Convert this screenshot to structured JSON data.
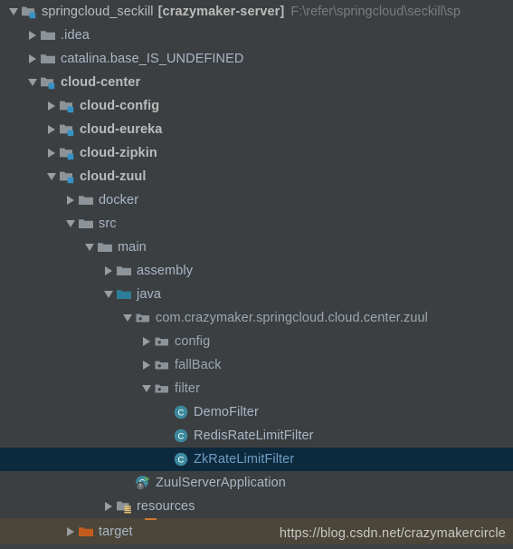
{
  "window": {
    "kind": "ide-project-tree",
    "background_color": "#3c3f41",
    "selection_color": "#0d293e",
    "bottom_bar_color": "#4b4639"
  },
  "project": {
    "name": "springcloud_seckill",
    "module_tag": "[crazymaker-server]",
    "path": "F:\\refer\\springcloud\\seckill\\sp"
  },
  "watermark": "https://blog.csdn.net/crazymakercircle",
  "tree": {
    "rows": [
      {
        "label": "springcloud_seckill",
        "tag": "[crazymaker-server]",
        "path": "F:\\refer\\springcloud\\seckill\\sp",
        "icon": "module-folder-icon",
        "toggle": "expanded",
        "depth": 0,
        "style": "proj",
        "selected": false
      },
      {
        "label": ".idea",
        "icon": "folder-icon",
        "toggle": "collapsed",
        "depth": 1,
        "style": "plain",
        "selected": false
      },
      {
        "label": "catalina.base_IS_UNDEFINED",
        "icon": "folder-icon",
        "toggle": "collapsed",
        "depth": 1,
        "style": "plain",
        "selected": false
      },
      {
        "label": "cloud-center",
        "icon": "module-folder-icon",
        "toggle": "expanded",
        "depth": 1,
        "style": "bold",
        "selected": false
      },
      {
        "label": "cloud-config",
        "icon": "module-folder-icon",
        "toggle": "collapsed",
        "depth": 2,
        "style": "bold",
        "selected": false
      },
      {
        "label": "cloud-eureka",
        "icon": "module-folder-icon",
        "toggle": "collapsed",
        "depth": 2,
        "style": "bold",
        "selected": false
      },
      {
        "label": "cloud-zipkin",
        "icon": "module-folder-icon",
        "toggle": "collapsed",
        "depth": 2,
        "style": "bold",
        "selected": false
      },
      {
        "label": "cloud-zuul",
        "icon": "module-folder-icon",
        "toggle": "expanded",
        "depth": 2,
        "style": "bold",
        "selected": false
      },
      {
        "label": "docker",
        "icon": "folder-icon",
        "toggle": "collapsed",
        "depth": 3,
        "style": "plain",
        "selected": false
      },
      {
        "label": "src",
        "icon": "folder-icon",
        "toggle": "expanded",
        "depth": 3,
        "style": "plain",
        "selected": false
      },
      {
        "label": "main",
        "icon": "folder-icon",
        "toggle": "expanded",
        "depth": 4,
        "style": "plain",
        "selected": false
      },
      {
        "label": "assembly",
        "icon": "folder-icon",
        "toggle": "collapsed",
        "depth": 5,
        "style": "plain",
        "selected": false
      },
      {
        "label": "java",
        "icon": "source-root-folder-icon",
        "toggle": "expanded",
        "depth": 5,
        "style": "plain",
        "selected": false
      },
      {
        "label": "com.crazymaker.springcloud.cloud.center.zuul",
        "icon": "package-icon",
        "toggle": "expanded",
        "depth": 6,
        "style": "pkg",
        "selected": false
      },
      {
        "label": "config",
        "icon": "package-icon",
        "toggle": "collapsed",
        "depth": 7,
        "style": "pkg",
        "selected": false
      },
      {
        "label": "fallBack",
        "icon": "package-icon",
        "toggle": "collapsed",
        "depth": 7,
        "style": "pkg",
        "selected": false
      },
      {
        "label": "filter",
        "icon": "package-icon",
        "toggle": "expanded",
        "depth": 7,
        "style": "pkg",
        "selected": false
      },
      {
        "label": "DemoFilter",
        "icon": "java-class-icon",
        "toggle": "none",
        "depth": 8,
        "style": "cls",
        "selected": false
      },
      {
        "label": "RedisRateLimitFilter",
        "icon": "java-class-icon",
        "toggle": "none",
        "depth": 8,
        "style": "cls",
        "selected": false
      },
      {
        "label": "ZkRateLimitFilter",
        "icon": "java-class-icon",
        "toggle": "none",
        "depth": 8,
        "style": "selcls",
        "selected": true
      },
      {
        "label": "ZuulServerApplication",
        "icon": "runnable-class-icon",
        "toggle": "none",
        "depth": 6,
        "style": "cls",
        "selected": false
      },
      {
        "label": "resources",
        "icon": "resources-root-folder-icon",
        "toggle": "collapsed",
        "depth": 5,
        "style": "plain",
        "selected": false
      },
      {
        "label": "target",
        "icon": "excluded-folder-icon",
        "toggle": "collapsed",
        "depth": 3,
        "style": "plain",
        "selected": false
      }
    ]
  },
  "colors": {
    "folder_gray": "#8d9499",
    "module_badge_blue": "#3592c4",
    "source_root_teal": "#2c7e9b",
    "excluded_orange": "#c45c20",
    "class_circle_teal": "#3d8a9e",
    "run_arrow_green": "#59a869",
    "resource_badge_yellow": "#e8bf6a",
    "text_default": "#a9b7c6",
    "text_path": "#787b7d"
  }
}
